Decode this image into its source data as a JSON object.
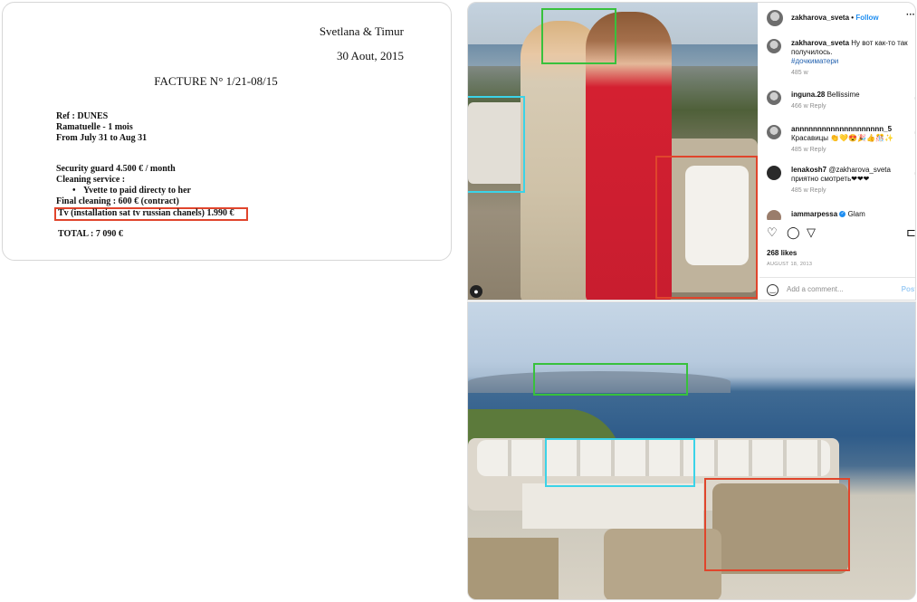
{
  "invoice": {
    "names": "Svetlana & Timur",
    "date": "30 Aout,  2015",
    "title": "FACTURE N° 1/21-08/15",
    "ref_lines": [
      "Ref : DUNES",
      "Ramatuelle - 1 mois",
      "From July 31 to Aug 31"
    ],
    "services": {
      "security": "Security guard 4.500 € / month",
      "cleaning": "Cleaning service :",
      "bullet": "Yvette  to paid directy to her",
      "final": "Final cleaning : 600 € (contract)"
    },
    "tv_line": "Tv (installation sat tv russian chanels) 1.990 €",
    "total": "TOTAL : 7 090 €",
    "highlight_color": "#e0452c"
  },
  "post": {
    "username": "zakharova_sveta",
    "separator": "•",
    "follow_label": "Follow",
    "more_label": "···",
    "comments": [
      {
        "user": "zakharova_sveta",
        "text": " Ну вот как-то так получилось.",
        "tag": "#дочкиматери",
        "meta": "485 w"
      },
      {
        "user": "inguna.28",
        "text": " Bellissime",
        "meta": "466 w   Reply"
      },
      {
        "user": "annnnnnnnnnnnnnnnnnnn_5",
        "text": " Красавицы 👏💛😍🎉👍🎊✨",
        "meta": "485 w   Reply"
      },
      {
        "user": "lenakosh7",
        "text": " @zakharova_sveta приятно смотреть❤❤❤",
        "meta": "485 w   Reply"
      },
      {
        "user": "iammarpessa",
        "text": " Glam",
        "meta": ""
      }
    ],
    "likes": "268 likes",
    "date": "AUGUST 18, 2013",
    "add_comment_placeholder": "Add a comment...",
    "post_label": "Post",
    "icons": [
      "heart-icon",
      "comment-icon",
      "share-icon",
      "bookmark-icon",
      "smile-icon",
      "user-tag-icon"
    ]
  },
  "box_colors": {
    "green": "#38c13c",
    "cyan": "#3bd3e8",
    "red": "#e0452c"
  }
}
